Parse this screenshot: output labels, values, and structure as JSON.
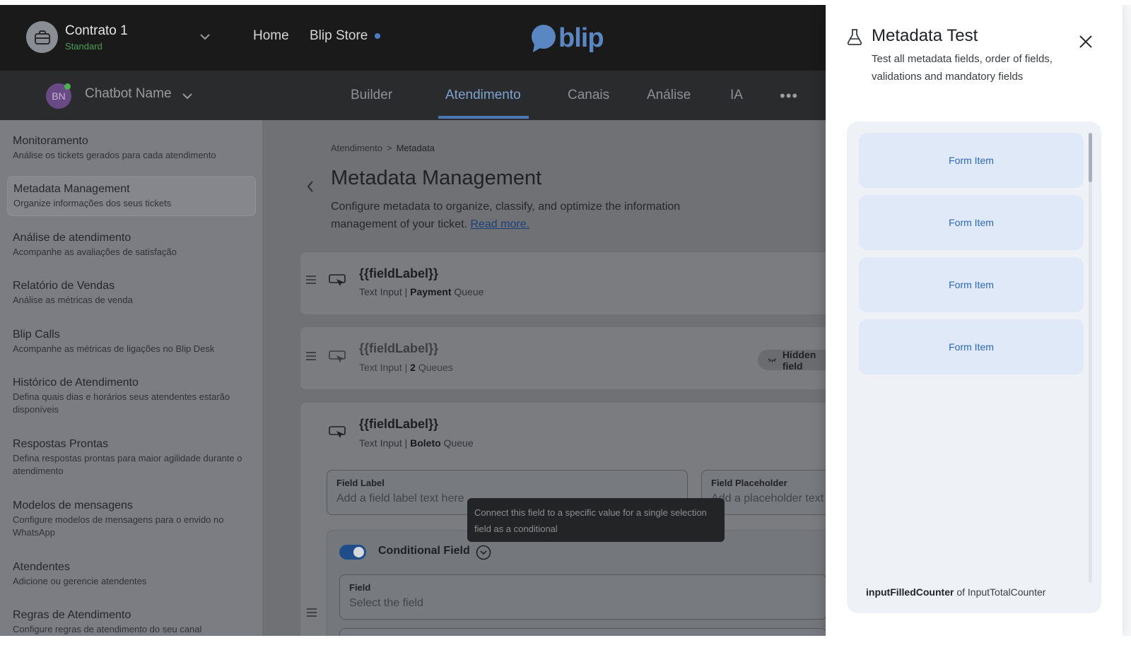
{
  "header": {
    "contract_name": "Contrato 1",
    "contract_plan": "Standard",
    "nav": {
      "home": "Home",
      "store": "Blip Store"
    },
    "logo_text": "blip"
  },
  "subnav": {
    "bot_initials": "BN",
    "bot_name": "Chatbot Name",
    "tabs": [
      "Builder",
      "Atendimento",
      "Canais",
      "Análise",
      "IA"
    ],
    "active_tab": "Atendimento",
    "more": "•••"
  },
  "sidebar": {
    "items": [
      {
        "title": "Monitoramento",
        "desc": "Análise os tickets gerados para cada atendimento"
      },
      {
        "title": "Metadata Management",
        "desc": "Organize informações dos seus tickets"
      },
      {
        "title": "Análise de atendimento",
        "desc": "Acompanhe as avaliações de satisfação"
      },
      {
        "title": "Relatório de Vendas",
        "desc": "Análise as métricas de venda"
      },
      {
        "title": "Blip Calls",
        "desc": "Acompanhe as métricas de ligações no Blip Desk"
      },
      {
        "title": "Histórico de Atendimento",
        "desc": "Defina quais dias e horários seus atendentes estarão disponíveis"
      },
      {
        "title": "Respostas Prontas",
        "desc": "Defina respostas prontas para maior agilidade durante o atendimento"
      },
      {
        "title": "Modelos de mensagens",
        "desc": "Configure modelos de mensagens para o envido no WhatsApp"
      },
      {
        "title": "Atendentes",
        "desc": "Adicione ou gerencie atendentes"
      },
      {
        "title": "Regras de Atendimento",
        "desc": "Configure regras de atendimento do seu canal"
      }
    ]
  },
  "main": {
    "breadcrumb": {
      "parent": "Atendimento",
      "separator": ">",
      "current": "Metadata"
    },
    "title": "Metadata Management",
    "description": "Configure metadata to organize, classify, and optimize the information management of your ticket.",
    "read_more": "Read more.",
    "fields": [
      {
        "label": "{{fieldLabel}}",
        "type": "Text Input",
        "sep": "|",
        "queue_strong": "Payment",
        "queue_suffix": "Queue"
      },
      {
        "label": "{{fieldLabel}}",
        "type": "Text Input",
        "sep": "|",
        "queue_strong": "2",
        "queue_suffix": "Queues",
        "chip": "Hidden field"
      },
      {
        "label": "{{fieldLabel}}",
        "type": "Text Input",
        "sep": "|",
        "queue_strong": "Boleto",
        "queue_suffix": "Queue"
      }
    ],
    "field_label_input": {
      "label": "Field Label",
      "placeholder": "Add a field label text here"
    },
    "field_placeholder_input": {
      "label": "Field Placeholder",
      "placeholder": "Add a placeholder text"
    },
    "conditional": {
      "label": "Conditional Field",
      "field_label": "Field",
      "field_placeholder": "Select the field",
      "tooltip": "Connect this field to a specific value for a single selection field as a conditional"
    }
  },
  "drawer": {
    "title": "Metadata Test",
    "subtitle": "Test all metadata fields, order of fields, validations and mandatory fields",
    "form_items": [
      "Form Item",
      "Form Item",
      "Form Item",
      "Form Item"
    ],
    "counter_filled": "inputFilledCounter",
    "counter_of": "of",
    "counter_total": "InputTotalCounter"
  },
  "colors": {
    "accent": "#2a67b7",
    "brand_logo": "#5a86c2",
    "tab_active": "#4b79b6",
    "status_online": "#4caf50"
  },
  "icons": {
    "contract": "briefcase-icon",
    "logo": "speech-bubble-icon",
    "drawer": "flask-icon",
    "close": "close-icon",
    "field": "cursor-click-icon",
    "hidden": "eye-closed-icon",
    "help": "question-icon"
  }
}
